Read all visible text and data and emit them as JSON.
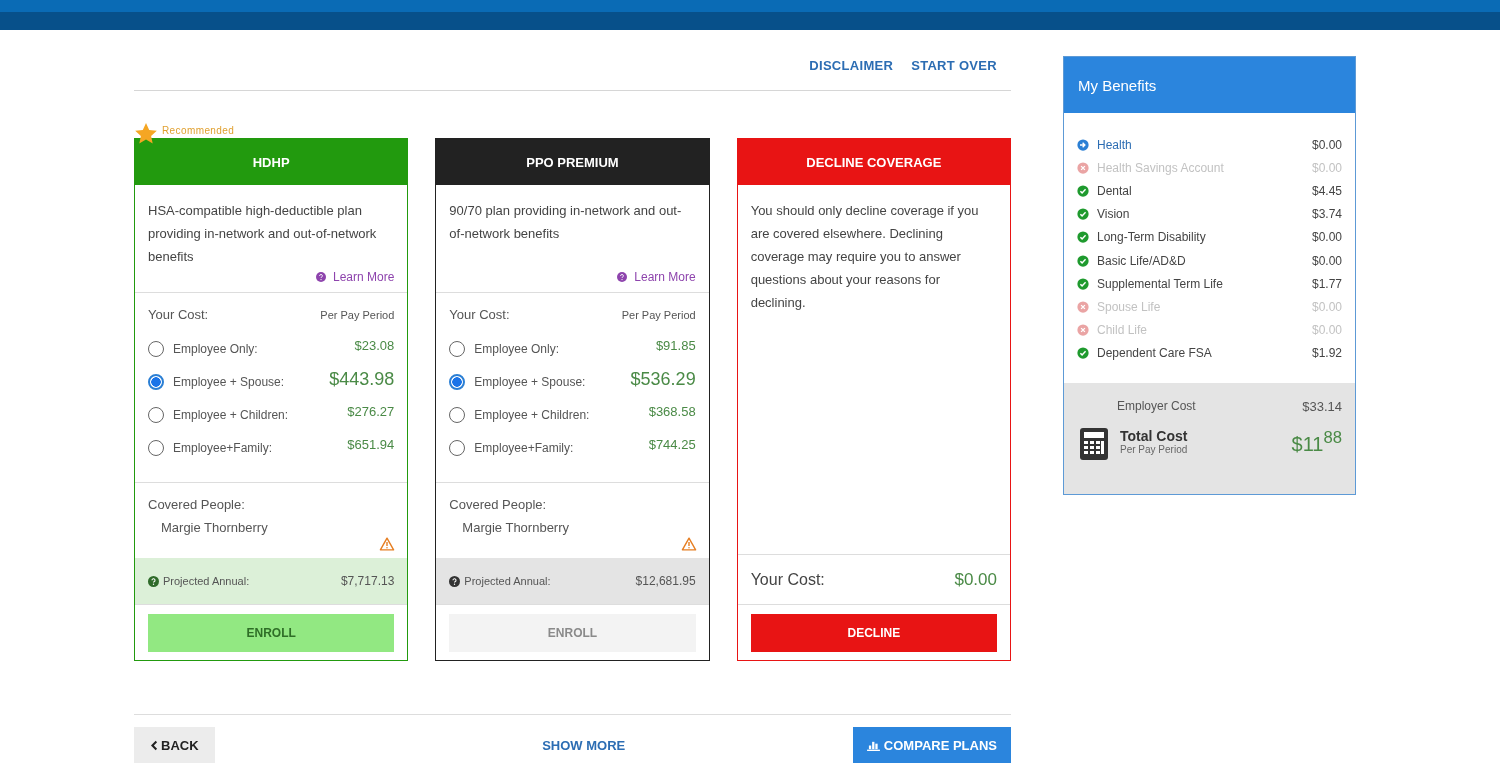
{
  "top_links": [
    "DISCLAIMER",
    "START OVER"
  ],
  "plans": [
    {
      "kind": "plan",
      "recommended": true,
      "recommended_label": "Recommended",
      "name": "HDHP",
      "color": "#229a0e",
      "description": "HSA-compatible high-deductible plan providing in-network and out-of-network benefits",
      "learn_more": "Learn More",
      "cost_label": "Your Cost:",
      "period_label": "Per Pay Period",
      "options": [
        {
          "label": "Employee Only:",
          "price": "$23.08",
          "selected": false
        },
        {
          "label": "Employee + Spouse:",
          "price": "$443.98",
          "selected": true
        },
        {
          "label": "Employee + Children:",
          "price": "$276.27",
          "selected": false
        },
        {
          "label": "Employee+Family:",
          "price": "$651.94",
          "selected": false
        }
      ],
      "covered_label": "Covered People:",
      "covered": [
        "Margie Thornberry"
      ],
      "projected_label": "Projected Annual:",
      "projected": "$7,717.13",
      "button": "ENROLL"
    },
    {
      "kind": "plan",
      "recommended": false,
      "name": "PPO PREMIUM",
      "color": "#222222",
      "description": "90/70 plan providing in-network and out-of-network benefits",
      "learn_more": "Learn More",
      "cost_label": "Your Cost:",
      "period_label": "Per Pay Period",
      "options": [
        {
          "label": "Employee Only:",
          "price": "$91.85",
          "selected": false
        },
        {
          "label": "Employee + Spouse:",
          "price": "$536.29",
          "selected": true
        },
        {
          "label": "Employee + Children:",
          "price": "$368.58",
          "selected": false
        },
        {
          "label": "Employee+Family:",
          "price": "$744.25",
          "selected": false
        }
      ],
      "covered_label": "Covered People:",
      "covered": [
        "Margie Thornberry"
      ],
      "projected_label": "Projected Annual:",
      "projected": "$12,681.95",
      "button": "ENROLL"
    },
    {
      "kind": "decline",
      "recommended": false,
      "name": "DECLINE COVERAGE",
      "color": "#e81414",
      "description": "You should only decline coverage if you are covered elsewhere. Declining coverage may require you to answer questions about your reasons for declining.",
      "cost_label": "Your Cost:",
      "cost": "$0.00",
      "button": "DECLINE"
    }
  ],
  "bottom": {
    "back": "BACK",
    "show_more": "SHOW MORE",
    "compare": "COMPARE PLANS"
  },
  "benefits": {
    "title": "My Benefits",
    "items": [
      {
        "name": "Health",
        "amount": "$0.00",
        "kind": "current"
      },
      {
        "name": "Health Savings Account",
        "amount": "$0.00",
        "kind": "declined"
      },
      {
        "name": "Dental",
        "amount": "$4.45",
        "kind": "enrolled"
      },
      {
        "name": "Vision",
        "amount": "$3.74",
        "kind": "enrolled"
      },
      {
        "name": "Long-Term Disability",
        "amount": "$0.00",
        "kind": "enrolled"
      },
      {
        "name": "Basic Life/AD&D",
        "amount": "$0.00",
        "kind": "enrolled"
      },
      {
        "name": "Supplemental Term Life",
        "amount": "$1.77",
        "kind": "enrolled"
      },
      {
        "name": "Spouse Life",
        "amount": "$0.00",
        "kind": "declined"
      },
      {
        "name": "Child Life",
        "amount": "$0.00",
        "kind": "declined"
      },
      {
        "name": "Dependent Care FSA",
        "amount": "$1.92",
        "kind": "enrolled"
      }
    ],
    "employer_label": "Employer Cost",
    "employer": "$33.14",
    "total_label": "Total Cost",
    "total_sub": "Per Pay Period",
    "total": "$11$^{88}$"
  }
}
